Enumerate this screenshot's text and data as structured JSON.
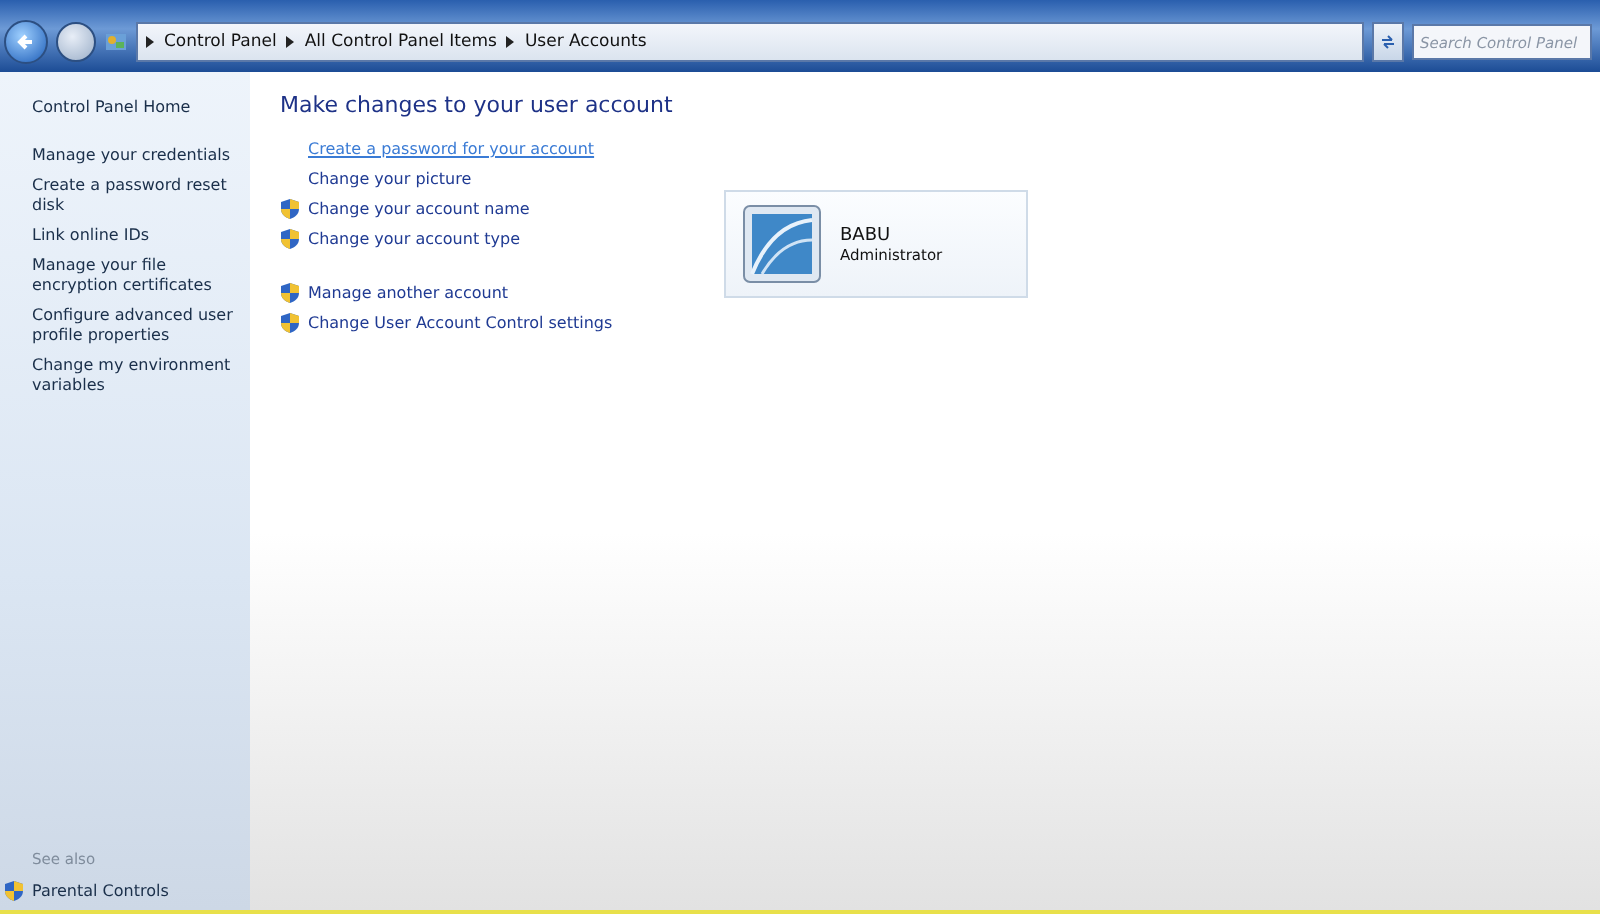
{
  "address_bar": {
    "breadcrumbs": [
      "Control Panel",
      "All Control Panel Items",
      "User Accounts"
    ],
    "search": {
      "placeholder": "Search Control Panel"
    }
  },
  "sidebar": {
    "groups": [
      [
        "Control Panel Home"
      ],
      [
        "Manage your credentials",
        "Create a password reset disk",
        "Link online IDs",
        "Manage your file encryption certificates",
        "Configure advanced user profile properties",
        "Change my environment variables"
      ]
    ],
    "see_also": {
      "heading": "See also",
      "items": [
        {
          "label": "Parental Controls",
          "shield": true
        }
      ]
    }
  },
  "main": {
    "heading": "Make changes to your user account",
    "action_groups": [
      [
        {
          "label": "Create a password for your account",
          "shield": false,
          "hovered": true
        },
        {
          "label": "Change your picture",
          "shield": false,
          "hovered": false
        },
        {
          "label": "Change your account name",
          "shield": true,
          "hovered": false
        },
        {
          "label": "Change your account type",
          "shield": true,
          "hovered": false
        }
      ],
      [
        {
          "label": "Manage another account",
          "shield": true,
          "hovered": false
        },
        {
          "label": "Change User Account Control settings",
          "shield": true,
          "hovered": false
        }
      ]
    ],
    "account": {
      "name": "BABU",
      "role": "Administrator"
    }
  }
}
